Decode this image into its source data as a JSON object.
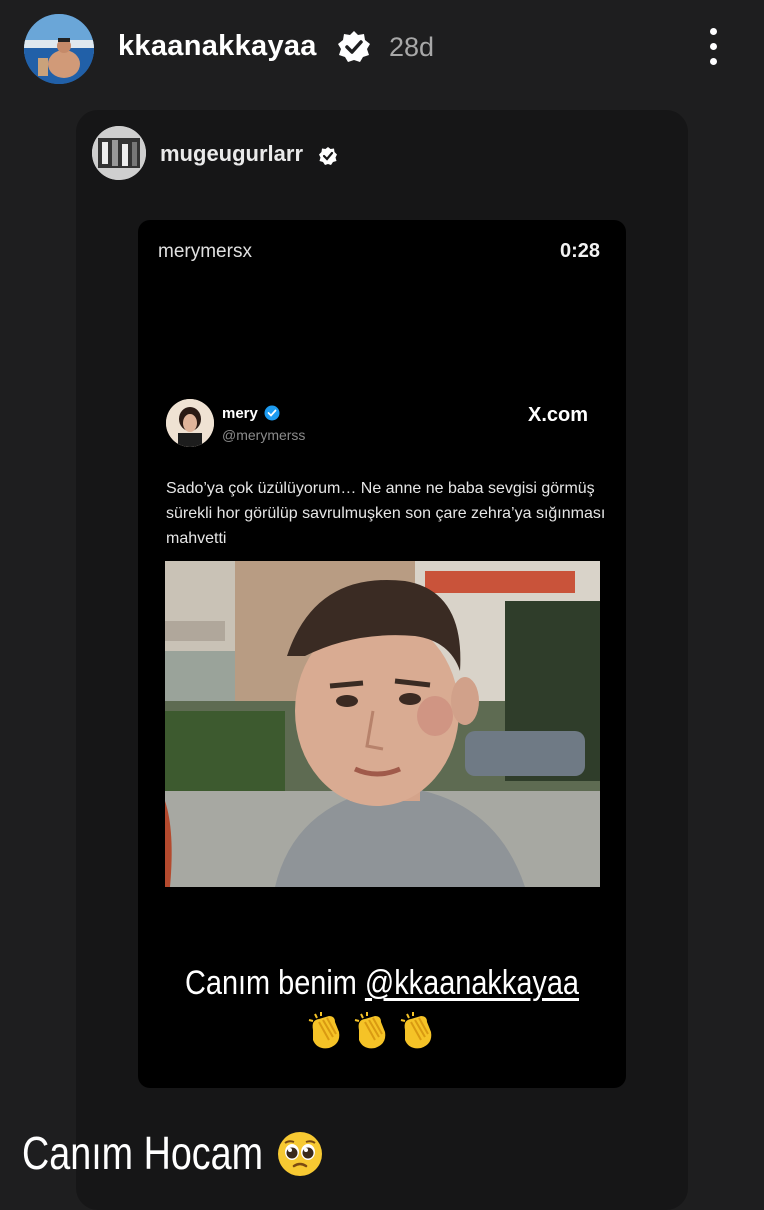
{
  "story": {
    "username": "kkaanakkayaa",
    "time_ago": "28d"
  },
  "shared_post": {
    "username": "mugeugurlarr"
  },
  "video": {
    "uploader": "merymersx",
    "duration": "0:28"
  },
  "tweet": {
    "name": "mery",
    "handle": "@merymerss",
    "site": "X.com",
    "text": "Sado’ya çok üzülüyorum… Ne anne ne baba sevgisi görmüş sürekli hor görülüp savrulmuşken son çare zehra’ya sığınması mahvetti"
  },
  "overlay": {
    "caption_prefix": "Canım benim ",
    "caption_mention": "@kkaanakkayaa"
  },
  "bottom": {
    "caption": "Canım Hocam"
  },
  "icons": {
    "verified": "verified-badge-icon",
    "menu": "more-options-icon",
    "clap": "clapping-hands-emoji",
    "face": "pleading-face-emoji"
  },
  "colors": {
    "background": "#1e1e1f",
    "card": "#161617",
    "verified_blue": "#1d9bf0"
  }
}
